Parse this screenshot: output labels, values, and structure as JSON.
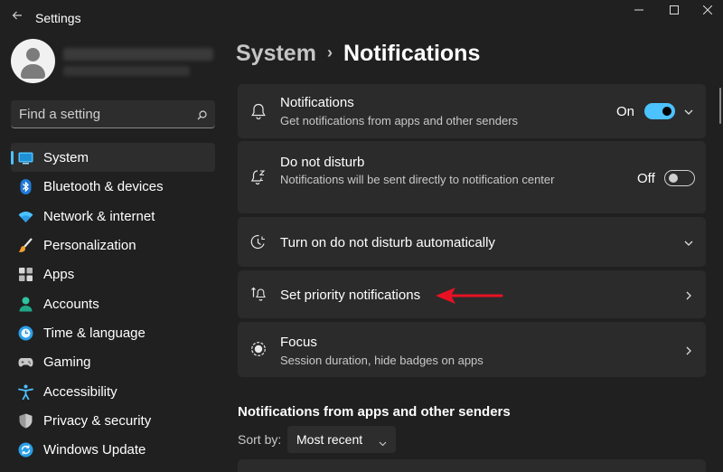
{
  "app": {
    "title": "Settings"
  },
  "search": {
    "placeholder": "Find a setting"
  },
  "sidebar": {
    "items": [
      {
        "label": "System",
        "icon": "system-monitor-icon",
        "active": true
      },
      {
        "label": "Bluetooth & devices",
        "icon": "bluetooth-icon"
      },
      {
        "label": "Network & internet",
        "icon": "wifi-icon"
      },
      {
        "label": "Personalization",
        "icon": "paintbrush-icon"
      },
      {
        "label": "Apps",
        "icon": "apps-grid-icon"
      },
      {
        "label": "Accounts",
        "icon": "person-icon"
      },
      {
        "label": "Time & language",
        "icon": "globe-clock-icon"
      },
      {
        "label": "Gaming",
        "icon": "gamepad-icon"
      },
      {
        "label": "Accessibility",
        "icon": "accessibility-icon"
      },
      {
        "label": "Privacy & security",
        "icon": "shield-icon"
      },
      {
        "label": "Windows Update",
        "icon": "sync-icon"
      }
    ]
  },
  "breadcrumb": {
    "parent": "System",
    "separator": "›",
    "current": "Notifications"
  },
  "cards": {
    "notifications": {
      "title": "Notifications",
      "subtitle": "Get notifications from apps and other senders",
      "toggle_label": "On"
    },
    "dnd": {
      "title": "Do not disturb",
      "subtitle": "Notifications will be sent directly to notification center",
      "toggle_label": "Off"
    },
    "dnd_auto": {
      "title": "Turn on do not disturb automatically"
    },
    "priority": {
      "title": "Set priority notifications"
    },
    "focus": {
      "title": "Focus",
      "subtitle": "Session duration, hide badges on apps"
    }
  },
  "section": {
    "heading": "Notifications from apps and other senders",
    "sort_label": "Sort by:",
    "sort_value": "Most recent"
  },
  "colors": {
    "accent": "#4cc2ff",
    "background": "#202020",
    "card": "#2b2b2b",
    "annotation_arrow": "#e81123"
  }
}
